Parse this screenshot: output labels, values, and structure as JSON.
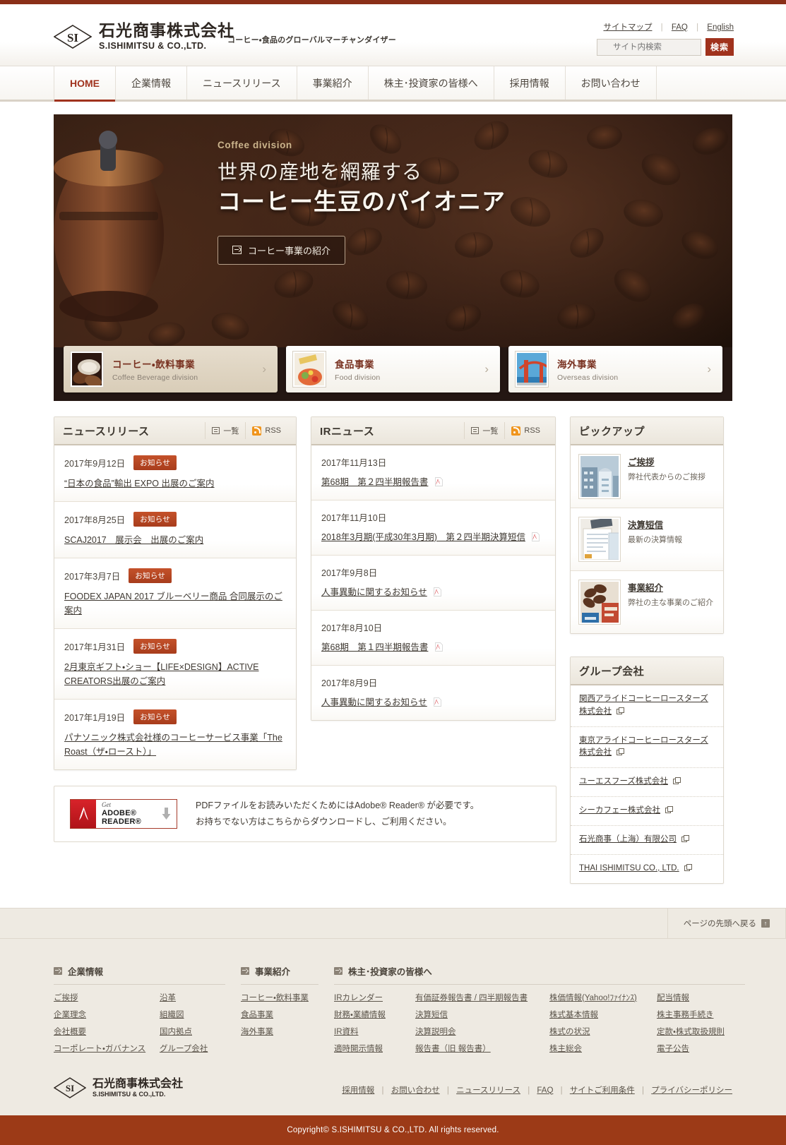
{
  "site": {
    "logo_jp": "石光商事株式会社",
    "logo_en": "S.ISHIMITSU & CO.,LTD.",
    "logo_mark": "SI",
    "tagline": "コーヒー・食品のグローバルマーチャンダイザー"
  },
  "utility": {
    "sitemap": "サイトマップ",
    "faq": "FAQ",
    "english": "English",
    "search_placeholder": "サイト内検索",
    "search_button": "検索"
  },
  "gnav": [
    {
      "label": "HOME",
      "active": true
    },
    {
      "label": "企業情報",
      "active": false
    },
    {
      "label": "ニュースリリース",
      "active": false
    },
    {
      "label": "事業紹介",
      "active": false
    },
    {
      "label": "株主･投資家の皆様へ",
      "active": false
    },
    {
      "label": "採用情報",
      "active": false
    },
    {
      "label": "お問い合わせ",
      "active": false
    }
  ],
  "hero": {
    "eyebrow": "Coffee division",
    "line1": "世界の産地を網羅する",
    "line2": "コーヒー生豆のパイオニア",
    "button": "コーヒー事業の紹介"
  },
  "divisions": [
    {
      "jp": "コーヒー・飲料事業",
      "en": "Coffee Beverage division",
      "selected": true
    },
    {
      "jp": "食品事業",
      "en": "Food division",
      "selected": false
    },
    {
      "jp": "海外事業",
      "en": "Overseas division",
      "selected": false
    }
  ],
  "news_panel": {
    "title": "ニュースリリース",
    "list_label": "一覧",
    "rss_label": "RSS",
    "items": [
      {
        "date": "2017年9月12日",
        "badge": "お知らせ",
        "title": "“日本の食品”輸出 EXPO 出展のご案内"
      },
      {
        "date": "2017年8月25日",
        "badge": "お知らせ",
        "title": "SCAJ2017　展示会　出展のご案内"
      },
      {
        "date": "2017年3月7日",
        "badge": "お知らせ",
        "title": "FOODEX JAPAN 2017 ブルーベリー商品 合同展示のご案内"
      },
      {
        "date": "2017年1月31日",
        "badge": "お知らせ",
        "title": "2月東京ギフト・ショー【LIFE×DESIGN】ACTIVE CREATORS出展のご案内"
      },
      {
        "date": "2017年1月19日",
        "badge": "お知らせ",
        "title": "パナソニック株式会社様のコーヒーサービス事業「The Roast（ザ・ロースト）」"
      }
    ]
  },
  "ir_panel": {
    "title": "IRニュース",
    "list_label": "一覧",
    "rss_label": "RSS",
    "items": [
      {
        "date": "2017年11月13日",
        "title": "第68期　第２四半期報告書",
        "pdf": true
      },
      {
        "date": "2017年11月10日",
        "title": "2018年3月期(平成30年3月期)　第２四半期決算短信",
        "pdf": true
      },
      {
        "date": "2017年9月8日",
        "title": "人事異動に関するお知らせ",
        "pdf": true
      },
      {
        "date": "2017年8月10日",
        "title": "第68期　第１四半期報告書",
        "pdf": true
      },
      {
        "date": "2017年8月9日",
        "title": "人事異動に関するお知らせ",
        "pdf": true
      }
    ]
  },
  "pickup_panel": {
    "title": "ピックアップ",
    "items": [
      {
        "title": "ご挨拶",
        "desc": "弊社代表からのご挨拶",
        "thumb": "building"
      },
      {
        "title": "決算短信",
        "desc": "最新の決算情報",
        "thumb": "documents"
      },
      {
        "title": "事業紹介",
        "desc": "弊社の主な事業のご紹介",
        "thumb": "beans"
      }
    ]
  },
  "group_panel": {
    "title": "グループ会社",
    "items": [
      "関西アライドコーヒーロースターズ株式会社",
      "東京アライドコーヒーロースターズ株式会社",
      "ユーエスフーズ株式会社",
      "シーカフェー株式会社",
      "石光商事（上海）有限公司",
      "THAI ISHIMITSU CO., LTD."
    ]
  },
  "adobe": {
    "get": "Get",
    "brand": "ADOBE® READER®",
    "line1": "PDFファイルをお読みいただくためにはAdobe® Reader® が必要です。",
    "line2": "お持ちでない方はこちらからダウンロードし、ご利用ください。"
  },
  "pagetop": {
    "label": "ページの先頭へ戻る"
  },
  "footer": {
    "sections": [
      {
        "heading": "企業情報",
        "columns": [
          [
            "ご挨拶",
            "企業理念",
            "会社概要",
            "コーポレート・ガバナンス"
          ],
          [
            "沿革",
            "組織図",
            "国内拠点",
            "グループ会社"
          ]
        ]
      },
      {
        "heading": "事業紹介",
        "columns": [
          [
            "コーヒー・飲料事業",
            "食品事業",
            "海外事業"
          ]
        ]
      },
      {
        "heading": "株主･投資家の皆様へ",
        "columns": [
          [
            "IRカレンダー",
            "財務・業績情報",
            "IR資料",
            "適時開示情報"
          ],
          [
            "有価証券報告書 / 四半期報告書",
            "決算短信",
            "決算説明会",
            "報告書（旧 報告書）"
          ],
          [
            "株価情報(Yahoo!ﾌｧｲﾅﾝｽ)",
            "株式基本情報",
            "株式の状況",
            "株主総会"
          ],
          [
            "配当情報",
            "株主事務手続き",
            "定款・株式取扱規則",
            "電子公告"
          ]
        ]
      }
    ],
    "bottom_links": [
      "採用情報",
      "お問い合わせ",
      "ニュースリリース",
      "FAQ",
      "サイトご利用条件",
      "プライバシーポリシー"
    ],
    "copyright": "Copyright© S.ISHIMITSU & CO.,LTD. All rights reserved."
  },
  "colors": {
    "brand_red": "#9c3a17",
    "accent": "#a0321d",
    "badge": "#b8441f",
    "rss_orange": "#f0951e"
  }
}
